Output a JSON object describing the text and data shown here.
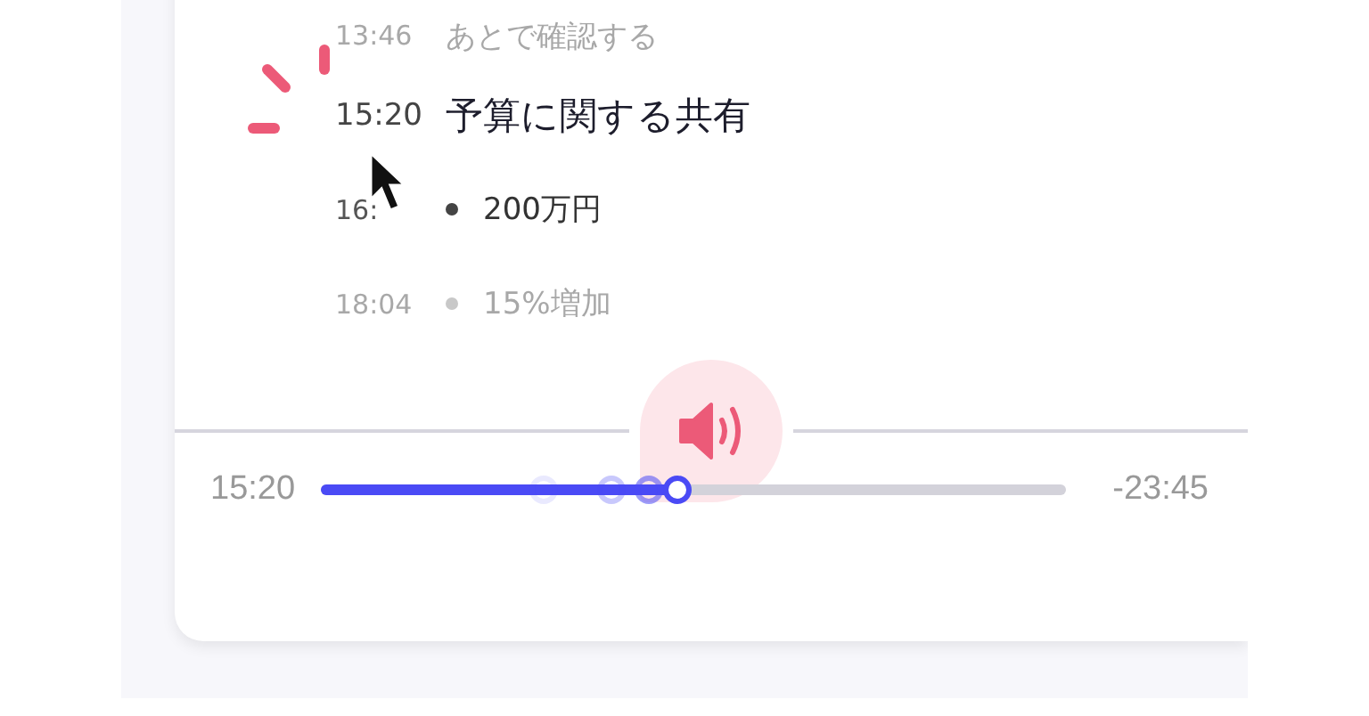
{
  "transcript": [
    {
      "time": "13:46",
      "text": "あとで確認する",
      "kind": "plain",
      "selected": false,
      "faded": true
    },
    {
      "time": "15:20",
      "text": "予算に関する共有",
      "kind": "heading",
      "selected": true,
      "faded": false
    },
    {
      "time": "16:",
      "text": "200万円",
      "kind": "bullet",
      "selected": false,
      "faded": false
    },
    {
      "time": "18:04",
      "text": "15%増加",
      "kind": "bullet",
      "selected": false,
      "faded": true
    }
  ],
  "player": {
    "elapsed": "15:20",
    "remaining": "-23:45",
    "level": 0.48,
    "sound_on": true
  }
}
